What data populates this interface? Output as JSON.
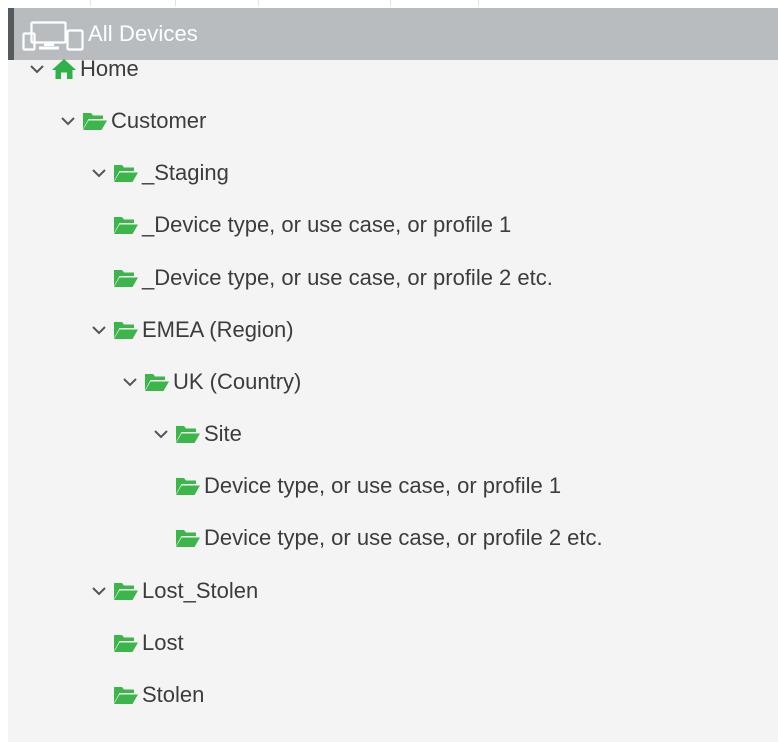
{
  "colors": {
    "folder": "#3cb54a",
    "home": "#2fb148",
    "header_bg": "#b9bcbf",
    "header_accent": "#555a5e",
    "panel_bg": "#f4f4f4",
    "text": "#3c3c3c"
  },
  "header": {
    "icon": "devices-icon",
    "title": "All Devices"
  },
  "tree": [
    {
      "id": "home",
      "label": "Home",
      "icon": "home-icon",
      "expanded": true,
      "depth": 0
    },
    {
      "id": "customer",
      "label": "Customer",
      "icon": "folder-open-icon",
      "expanded": true,
      "depth": 1
    },
    {
      "id": "staging",
      "label": "_Staging",
      "icon": "folder-open-icon",
      "expanded": true,
      "depth": 2
    },
    {
      "id": "staging-profile-1",
      "label": "_Device type, or use case, or profile 1",
      "icon": "folder-open-icon",
      "depth": 3
    },
    {
      "id": "staging-profile-2",
      "label": "_Device type, or use case, or profile 2 etc.",
      "icon": "folder-open-icon",
      "depth": 3
    },
    {
      "id": "emea",
      "label": "EMEA (Region)",
      "icon": "folder-open-icon",
      "expanded": true,
      "depth": 2
    },
    {
      "id": "uk",
      "label": "UK (Country)",
      "icon": "folder-open-icon",
      "expanded": true,
      "depth": 3
    },
    {
      "id": "site",
      "label": "Site",
      "icon": "folder-open-icon",
      "expanded": true,
      "depth": 4
    },
    {
      "id": "site-profile-1",
      "label": "Device type, or use case, or profile 1",
      "icon": "folder-open-icon",
      "depth": 5
    },
    {
      "id": "site-profile-2",
      "label": "Device type, or use case, or profile 2 etc.",
      "icon": "folder-open-icon",
      "depth": 5
    },
    {
      "id": "lost-stolen",
      "label": "Lost_Stolen",
      "icon": "folder-open-icon",
      "expanded": true,
      "depth": 2
    },
    {
      "id": "lost",
      "label": "Lost",
      "icon": "folder-open-icon",
      "depth": 3
    },
    {
      "id": "stolen",
      "label": "Stolen",
      "icon": "folder-open-icon",
      "depth": 3
    }
  ]
}
